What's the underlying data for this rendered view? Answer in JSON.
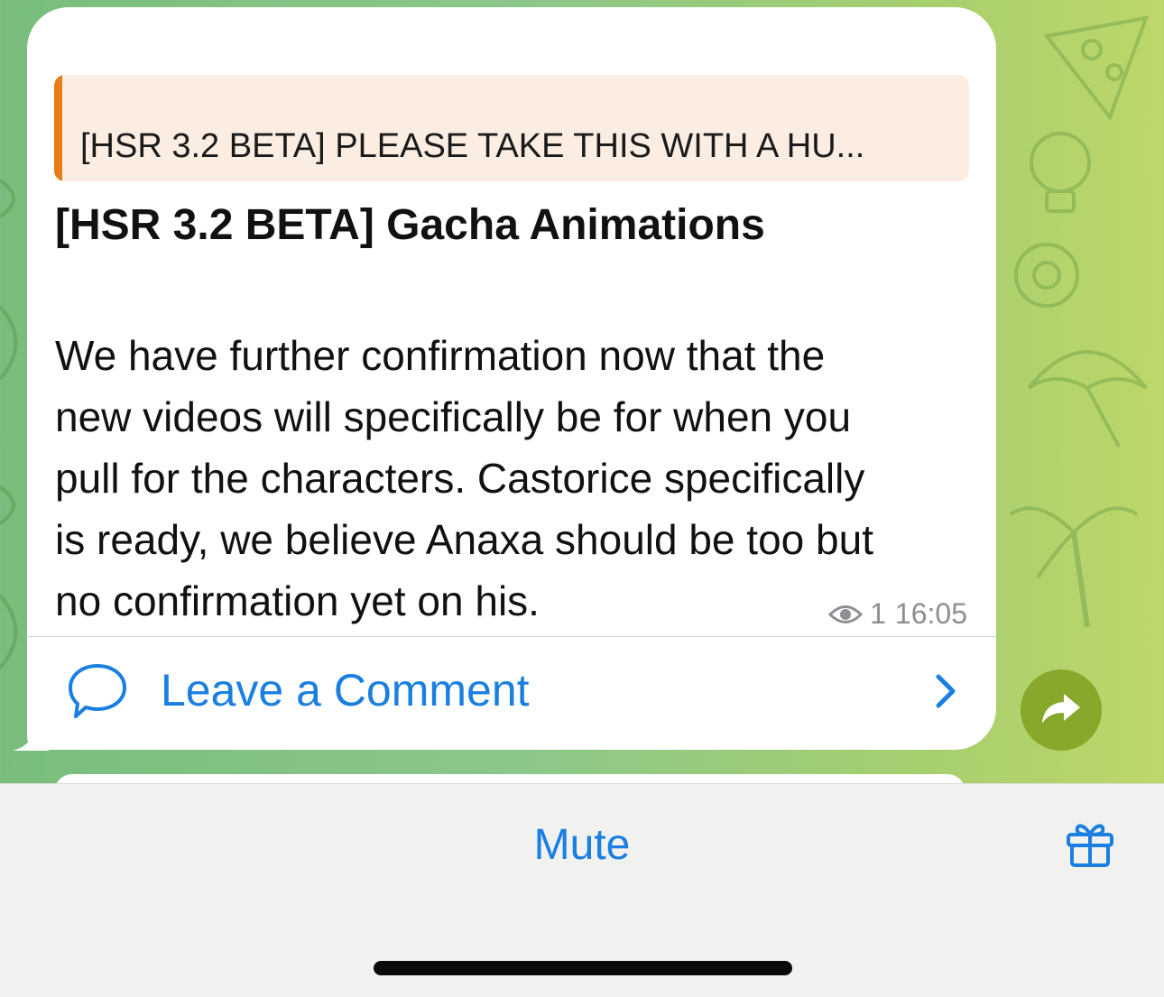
{
  "message": {
    "reply_quote": "[HSR 3.2 BETA] PLEASE TAKE THIS WITH A HU...",
    "title": "[HSR 3.2 BETA] Gacha Animations",
    "body_lines": [
      "We have further confirmation now that the",
      "new videos will specifically be for when you",
      "pull for the characters. Castorice specifically",
      "is ready, we believe Anaxa should be too but",
      "no confirmation yet on his."
    ],
    "views": "1",
    "time": "16:05",
    "comment_label": "Leave a Comment"
  },
  "bottom_bar": {
    "mute_label": "Mute"
  },
  "icons": {
    "views": "eye-icon",
    "comment": "speech-bubble-icon",
    "chevron": "chevron-right-icon",
    "share": "share-arrow-icon",
    "gift": "gift-icon"
  },
  "colors": {
    "accent": "#1a7fe0",
    "quote_bar": "#e97b16",
    "quote_bg": "#fcede3",
    "share_button": "#88a82c",
    "bottom_bar_bg": "#f1f1ef"
  }
}
